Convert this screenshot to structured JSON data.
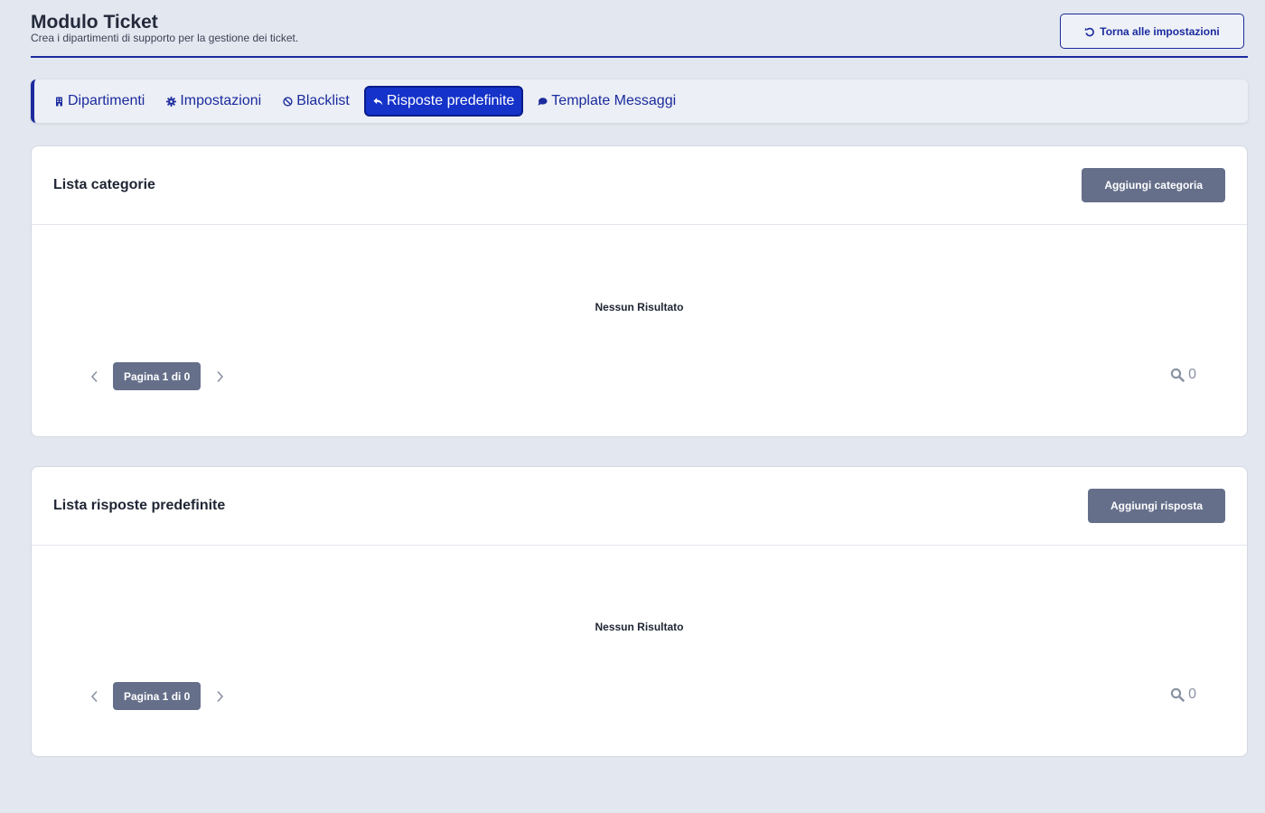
{
  "header": {
    "title": "Modulo Ticket",
    "subtitle": "Crea i dipartimenti di supporto per la gestione dei ticket.",
    "back_button": "Torna alle impostazioni"
  },
  "tabs": [
    {
      "label": "Dipartimenti",
      "icon": "building-icon",
      "active": false
    },
    {
      "label": "Impostazioni",
      "icon": "gear-icon",
      "active": false
    },
    {
      "label": "Blacklist",
      "icon": "ban-icon",
      "active": false
    },
    {
      "label": "Risposte predefinite",
      "icon": "reply-icon",
      "active": true
    },
    {
      "label": "Template Messaggi",
      "icon": "comment-icon",
      "active": false
    }
  ],
  "categories_card": {
    "title": "Lista categorie",
    "add_button": "Aggiungi categoria",
    "empty_message": "Nessun Risultato",
    "page_label": "Pagina 1 di 0",
    "result_count": "0"
  },
  "responses_card": {
    "title": "Lista risposte predefinite",
    "add_button": "Aggiungi risposta",
    "empty_message": "Nessun Risultato",
    "page_label": "Pagina 1 di 0",
    "result_count": "0"
  },
  "colors": {
    "accent": "#1b2b9e",
    "active_tab": "#1532c9",
    "button_gray": "#656f8a",
    "background": "#e3e7ef"
  }
}
